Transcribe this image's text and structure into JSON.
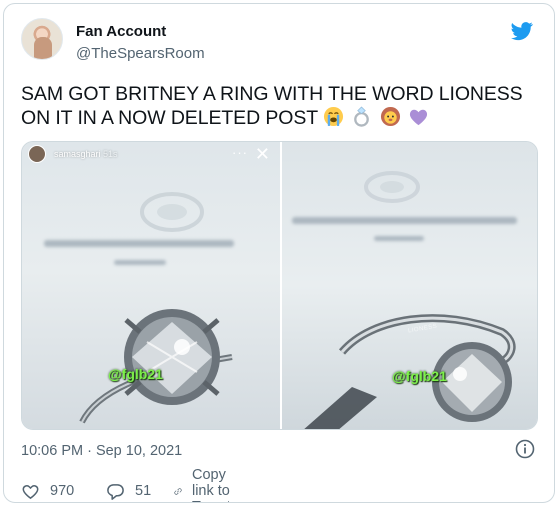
{
  "tweet": {
    "author": {
      "display_name": "Fan Account",
      "handle": "@TheSpearsRoom"
    },
    "brand_icon": "twitter-bird-icon",
    "text": "SAM GOT BRITNEY A RING WITH THE WORD LIONESS ON IT IN A NOW DELETED POST",
    "emojis": [
      "loudly-crying-face-icon",
      "ring-icon",
      "lion-face-icon",
      "purple-heart-icon"
    ],
    "timestamp": "10:06 PM · Sep 10, 2021",
    "info_icon": "info-icon",
    "media": {
      "left": {
        "story_user": "samasghari",
        "story_time": "51s",
        "dots": "···",
        "close": "✕",
        "watermark": "@fglb21"
      },
      "right": {
        "watermark": "@fglb21",
        "ring_engraving": "LIONESS"
      }
    },
    "actions": {
      "likes": "970",
      "replies": "51",
      "copy_link": "Copy link to Tweet"
    }
  },
  "colors": {
    "accent": "#1d9bf0",
    "text": "#0f1419",
    "muted": "#536471",
    "border": "#cfd9de",
    "watermark": "#7df04b"
  }
}
